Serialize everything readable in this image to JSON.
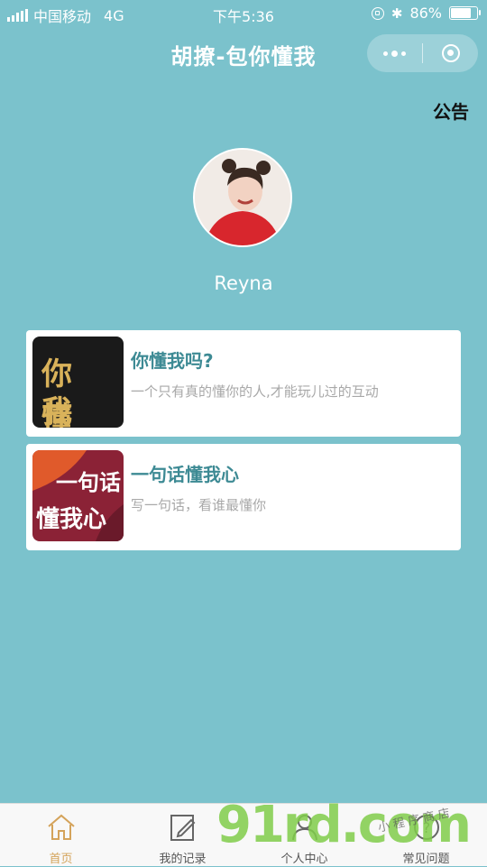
{
  "status_bar": {
    "carrier": "中国移动",
    "network": "4G",
    "time": "下午5:36",
    "battery": "86%",
    "battery_level": 0.86
  },
  "nav": {
    "title": "胡撩-包你懂我",
    "more_icon": "more-dots-icon",
    "close_icon": "close-circle-icon"
  },
  "notice": "公告",
  "user": {
    "name": "Reyna"
  },
  "cards": [
    {
      "title": "你懂我吗?",
      "desc": "一个只有真的懂你的人,才能玩儿过的互动",
      "thumb_text_1": "你 懂",
      "thumb_text_2": "我 吗"
    },
    {
      "title": "一句话懂我心",
      "desc": "写一句话，看谁最懂你",
      "thumb_text_1": "一句话",
      "thumb_text_2": "懂我心"
    }
  ],
  "tabs": [
    {
      "label": "首页",
      "icon": "home-icon"
    },
    {
      "label": "我的记录",
      "icon": "edit-note-icon"
    },
    {
      "label": "个人中心",
      "icon": "user-icon"
    },
    {
      "label": "常见问题",
      "icon": "help-icon"
    }
  ],
  "watermark": {
    "text": "91rd.com",
    "subtext": "小程序商店"
  },
  "colors": {
    "background": "#7bc2cc",
    "accent": "#3d8a94",
    "active_tab": "#d4a35a"
  }
}
